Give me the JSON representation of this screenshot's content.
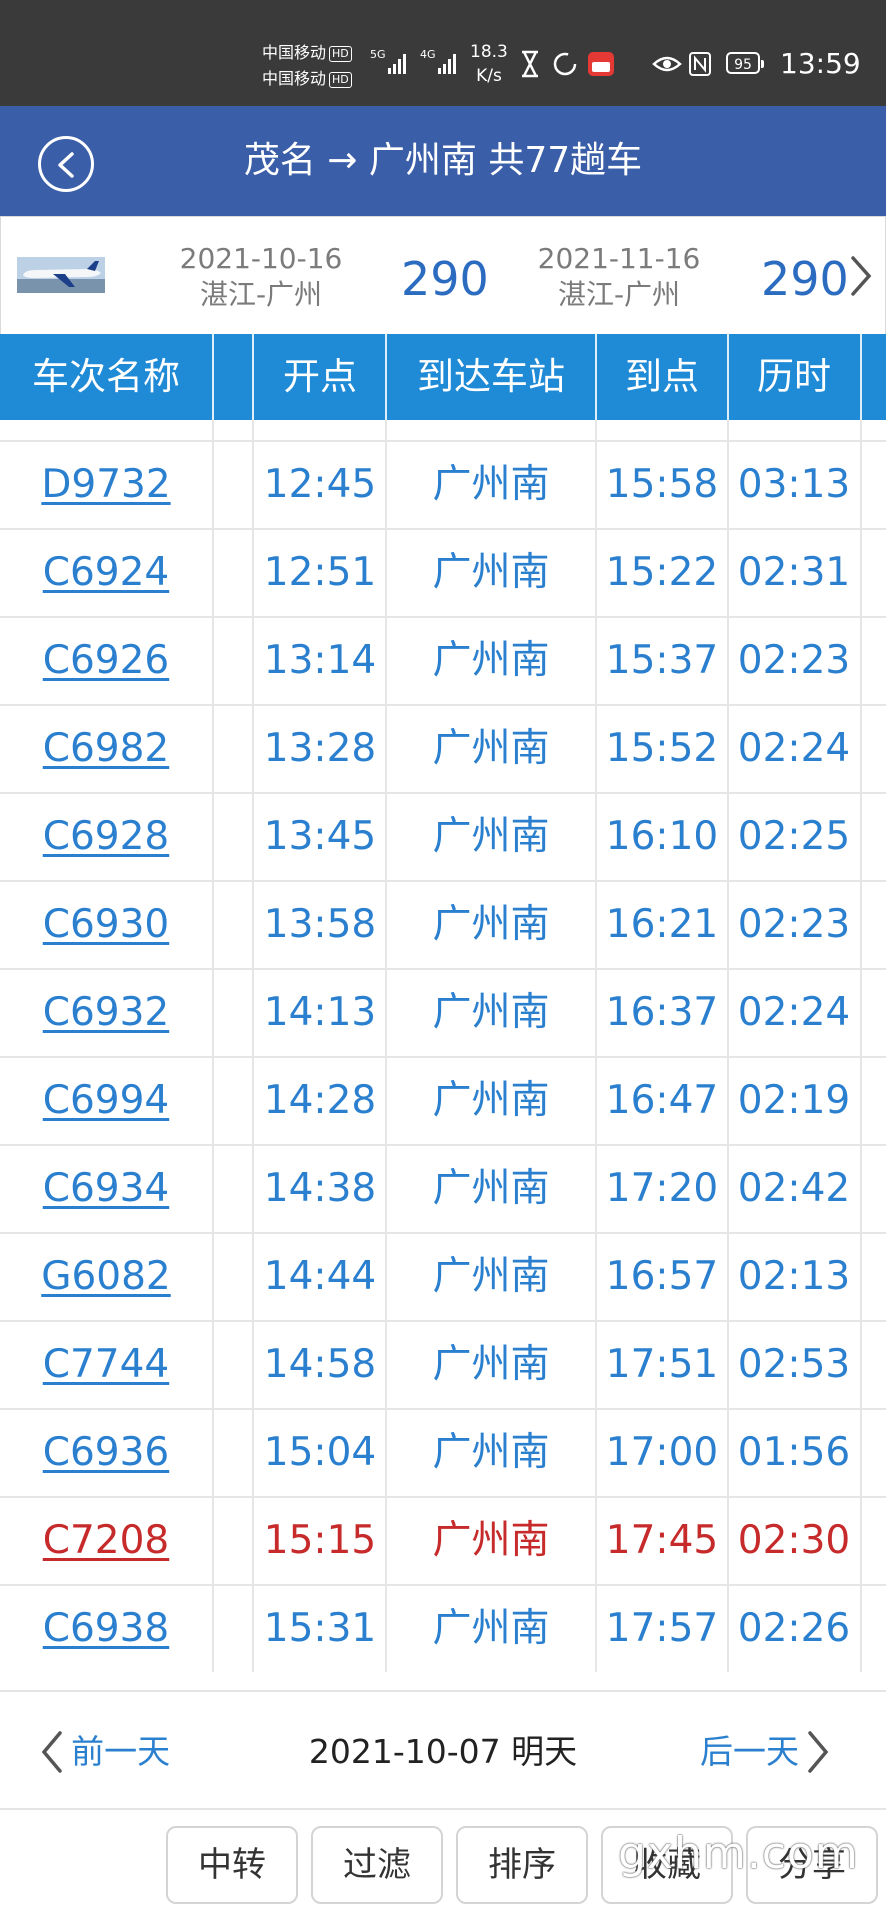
{
  "status_bar": {
    "carrier1": "中国移动",
    "carrier2": "中国移动",
    "hd_badge": "HD",
    "net1": "5G",
    "net2": "4G",
    "speed_value": "18.3",
    "speed_unit": "K/s",
    "battery": "95",
    "time": "13:59"
  },
  "header": {
    "title": "茂名 → 广州南 共77趟车"
  },
  "promo": {
    "left": {
      "date": "2021-10-16",
      "route": "湛江-广州",
      "price": "290"
    },
    "right": {
      "date": "2021-11-16",
      "route": "湛江-广州",
      "price": "290"
    }
  },
  "table": {
    "columns": [
      "车次名称",
      "开点",
      "到达车站",
      "到点",
      "历时"
    ],
    "rows": [
      {
        "train": "D9732",
        "depart": "12:45",
        "station": "广州南",
        "arrive": "15:58",
        "duration": "03:13",
        "highlight": false
      },
      {
        "train": "C6924",
        "depart": "12:51",
        "station": "广州南",
        "arrive": "15:22",
        "duration": "02:31",
        "highlight": false
      },
      {
        "train": "C6926",
        "depart": "13:14",
        "station": "广州南",
        "arrive": "15:37",
        "duration": "02:23",
        "highlight": false
      },
      {
        "train": "C6982",
        "depart": "13:28",
        "station": "广州南",
        "arrive": "15:52",
        "duration": "02:24",
        "highlight": false
      },
      {
        "train": "C6928",
        "depart": "13:45",
        "station": "广州南",
        "arrive": "16:10",
        "duration": "02:25",
        "highlight": false
      },
      {
        "train": "C6930",
        "depart": "13:58",
        "station": "广州南",
        "arrive": "16:21",
        "duration": "02:23",
        "highlight": false
      },
      {
        "train": "C6932",
        "depart": "14:13",
        "station": "广州南",
        "arrive": "16:37",
        "duration": "02:24",
        "highlight": false
      },
      {
        "train": "C6994",
        "depart": "14:28",
        "station": "广州南",
        "arrive": "16:47",
        "duration": "02:19",
        "highlight": false
      },
      {
        "train": "C6934",
        "depart": "14:38",
        "station": "广州南",
        "arrive": "17:20",
        "duration": "02:42",
        "highlight": false
      },
      {
        "train": "G6082",
        "depart": "14:44",
        "station": "广州南",
        "arrive": "16:57",
        "duration": "02:13",
        "highlight": false
      },
      {
        "train": "C7744",
        "depart": "14:58",
        "station": "广州南",
        "arrive": "17:51",
        "duration": "02:53",
        "highlight": false
      },
      {
        "train": "C6936",
        "depart": "15:04",
        "station": "广州南",
        "arrive": "17:00",
        "duration": "01:56",
        "highlight": false
      },
      {
        "train": "C7208",
        "depart": "15:15",
        "station": "广州南",
        "arrive": "17:45",
        "duration": "02:30",
        "highlight": true
      },
      {
        "train": "C6938",
        "depart": "15:31",
        "station": "广州南",
        "arrive": "17:57",
        "duration": "02:26",
        "highlight": false
      }
    ]
  },
  "date_nav": {
    "prev": "前一天",
    "current": "2021-10-07 明天",
    "next": "后一天"
  },
  "buttons": {
    "transfer": "中转",
    "filter": "过滤",
    "sort": "排序",
    "favorite": "收藏",
    "share": "分享"
  },
  "watermark": "gxhm.com",
  "colors": {
    "header_bg": "#3a5ea8",
    "table_header_bg": "#1f8ad6",
    "text_blue": "#2a7fcf",
    "text_red": "#c62a2a"
  }
}
